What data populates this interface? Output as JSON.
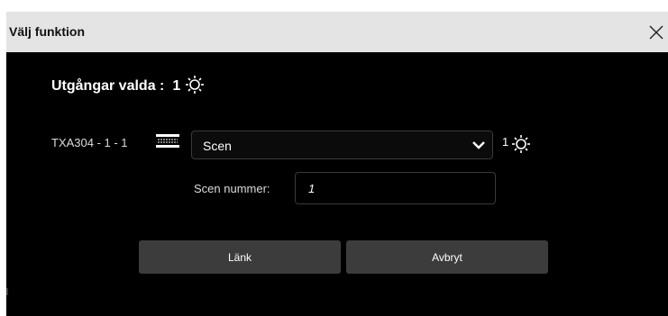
{
  "dialog": {
    "title": "Välj funktion",
    "close_icon": "close-icon"
  },
  "heading": {
    "label": "Utgångar valda :",
    "count": "1",
    "icon": "lamp-icon"
  },
  "device": {
    "label": "TXA304 - 1 - 1",
    "icon": "blind-icon"
  },
  "function_select": {
    "selected": "Scen",
    "icon": "chevron-down-icon"
  },
  "selected_outputs": {
    "count": "1",
    "icon": "lamp-icon"
  },
  "scene_number": {
    "label": "Scen nummer:",
    "value": "1"
  },
  "buttons": {
    "link_label": "Länk",
    "cancel_label": "Avbryt"
  },
  "colors": {
    "titlebar": "#e4e4e4",
    "body": "#000000",
    "button": "#3c3c3c"
  }
}
